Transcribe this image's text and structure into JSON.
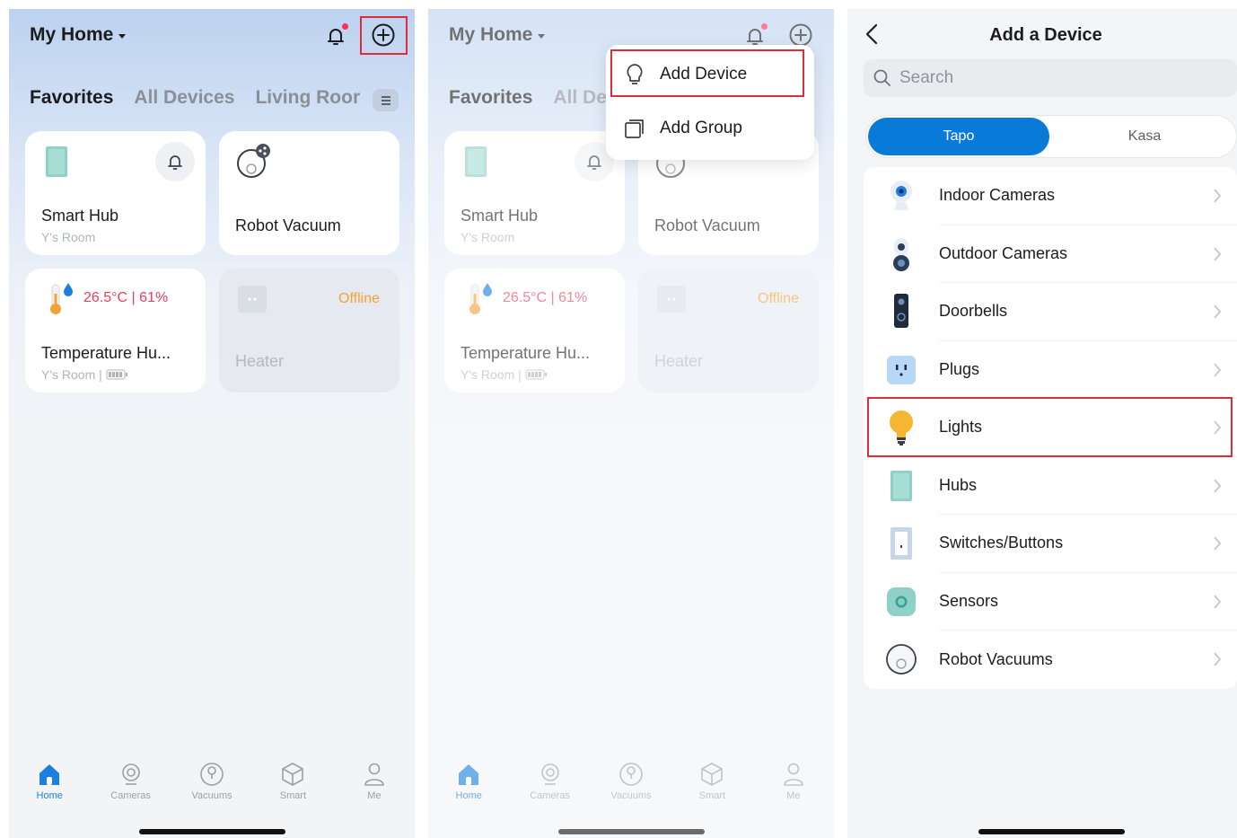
{
  "home": {
    "title": "My Home",
    "tabs": [
      "Favorites",
      "All Devices",
      "Living Roor"
    ],
    "tabs_short": [
      "Favorites",
      "All De"
    ],
    "devices": {
      "smart_hub": {
        "name": "Smart Hub",
        "room": "Y's Room"
      },
      "robot_vacuum": {
        "name": "Robot Vacuum"
      },
      "temp_sensor": {
        "name": "Temperature Hu...",
        "room": "Y's Room |",
        "reading": "26.5°C | 61%"
      },
      "heater": {
        "name": "Heater",
        "status": "Offline"
      }
    },
    "nav": [
      "Home",
      "Cameras",
      "Vacuums",
      "Smart",
      "Me"
    ]
  },
  "menu": {
    "add_device": "Add Device",
    "add_group": "Add Group"
  },
  "add_device_screen": {
    "title": "Add a Device",
    "search_placeholder": "Search",
    "brands": [
      "Tapo",
      "Kasa"
    ],
    "categories": [
      "Indoor Cameras",
      "Outdoor Cameras",
      "Doorbells",
      "Plugs",
      "Lights",
      "Hubs",
      "Switches/Buttons",
      "Sensors",
      "Robot Vacuums"
    ],
    "highlighted_category": "Lights"
  },
  "colors": {
    "accent": "#0a7ad8",
    "highlight": "#e02b3a",
    "temp": "#ee3b5e",
    "offline": "#f4a236"
  }
}
